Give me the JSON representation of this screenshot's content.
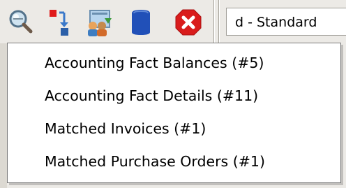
{
  "toolbar": {
    "icons": [
      "zoom-across-icon",
      "archive-report-icon",
      "workflow-users-icon",
      "database-icon",
      "close-icon"
    ],
    "combo_value": "d - Standard"
  },
  "zoom_menu": {
    "items": [
      {
        "label": "Accounting Fact Balances (#5)"
      },
      {
        "label": "Accounting Fact Details (#11)"
      },
      {
        "label": "Matched Invoices (#1)"
      },
      {
        "label": "Matched Purchase Orders (#1)"
      }
    ]
  },
  "colors": {
    "toolbar_bg": "#eceae6",
    "popup_bg": "#ffffff",
    "popup_border": "#7a7a7a",
    "close_red": "#d91c1c",
    "database_blue": "#2150b8"
  }
}
